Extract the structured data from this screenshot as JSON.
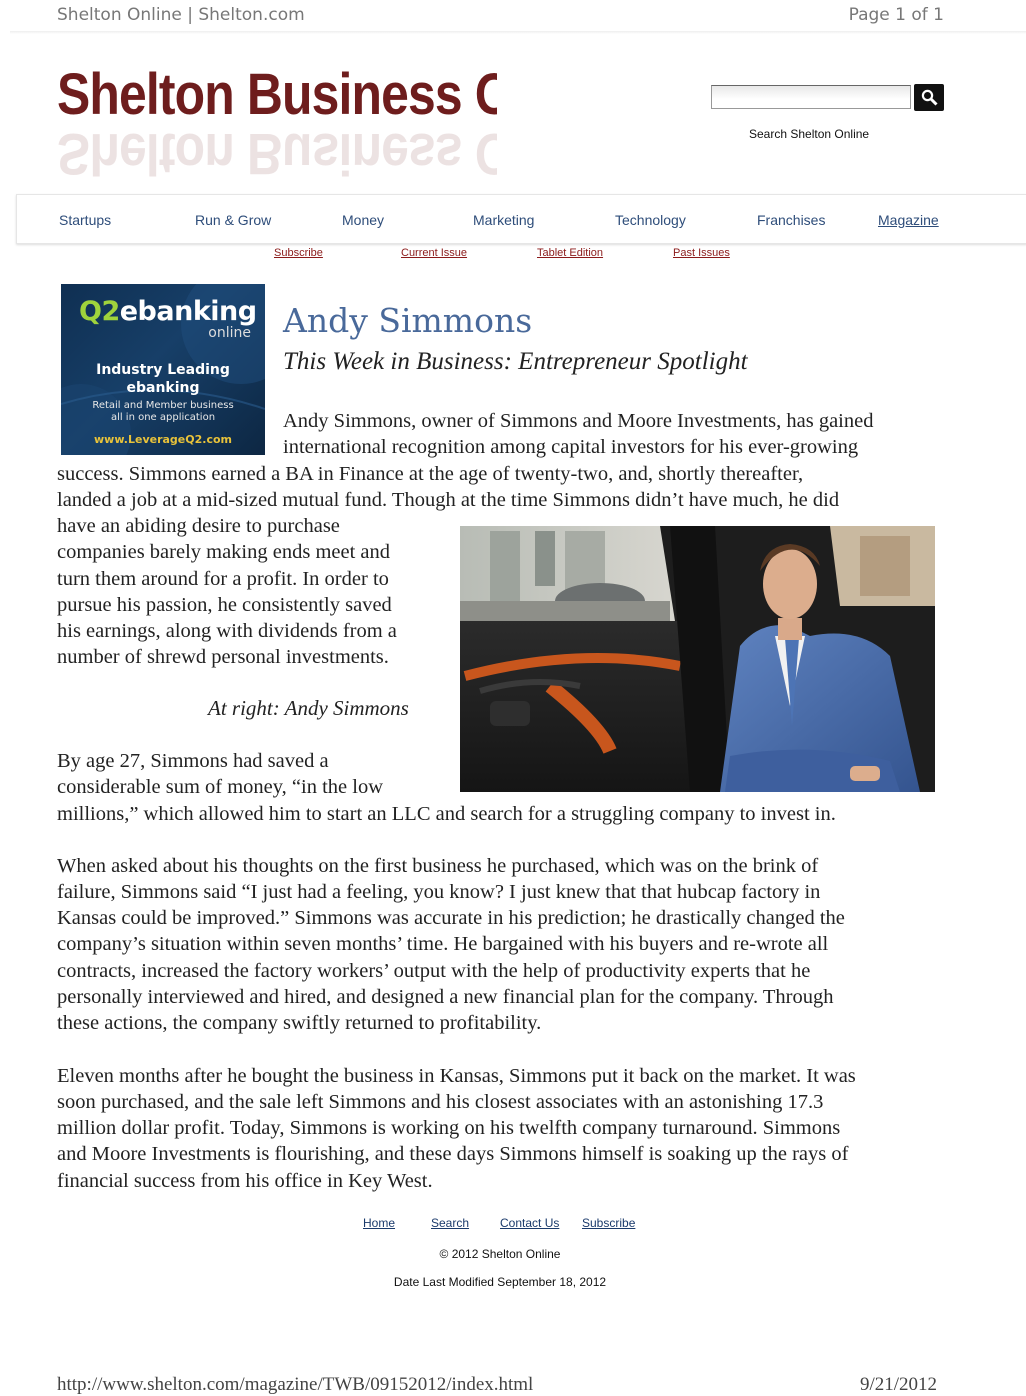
{
  "print_header": {
    "left": "Shelton Online | Shelton.com",
    "right": "Page 1 of 1"
  },
  "site": {
    "logo": "Shelton Business Online",
    "search_caption": "Search Shelton Online"
  },
  "nav": [
    "Startups",
    "Run & Grow",
    "Money",
    "Marketing",
    "Technology",
    "Franchises",
    "Magazine"
  ],
  "subnav": [
    "Subscribe",
    "Current Issue",
    "Tablet Edition",
    "Past Issues"
  ],
  "ad": {
    "logo_q2": "Q2",
    "logo_rest": "ebanking",
    "logo_sub": "online",
    "headline_1": "Industry Leading",
    "headline_2": "ebanking",
    "tagline_1": "Retail and Member business",
    "tagline_2": "all in one application",
    "url": "www.LeverageQ2.com"
  },
  "article": {
    "name": "Andy Simmons",
    "subtitle": "This Week in Business: Entrepreneur Spotlight",
    "lines_intro": [
      "Andy Simmons, owner of Simmons and Moore Investments, has gained",
      "international recognition among capital investors for his ever-growing"
    ],
    "lines_full1": [
      "success. Simmons earned a BA in Finance at the age of twenty-two, and, shortly thereafter,",
      "landed a job at a mid-sized mutual fund. Though at the time Simmons didn’t have much, he did"
    ],
    "lines_left": [
      "have an abiding desire to purchase",
      "companies barely making ends meet and",
      "turn them around for a profit. In order to",
      "pursue his passion, he consistently saved",
      "his earnings, along with dividends from a",
      "number of shrewd personal investments."
    ],
    "caption": "At right: Andy Simmons",
    "lines_left2": [
      "By age 27, Simmons had saved a",
      "considerable sum of money, “in the low"
    ],
    "line_full2": "millions,” which allowed him to start an LLC and search for a struggling company to invest in.",
    "para2": [
      "When asked about his thoughts on the first business he purchased, which was on the brink of",
      "failure, Simmons said “I just had a feeling, you know? I just knew that that hubcap factory in",
      "Kansas could be improved.” Simmons was accurate in his prediction; he drastically changed the",
      "company’s situation within seven months’ time. He bargained with his buyers and re-wrote all",
      "contracts, increased the factory workers’ output with the help of productivity experts that he",
      "personally interviewed and hired, and designed a new financial plan for the company. Through",
      "these actions, the company swiftly returned to profitability."
    ],
    "para3": [
      "Eleven months after he bought the business in Kansas, Simmons put it back on the market. It was",
      "soon purchased, and the sale left Simmons and his closest associates with an astonishing 17.3",
      "million dollar profit. Today, Simmons is working on his twelfth company turnaround. Simmons",
      "and Moore Investments is flourishing, and these days Simmons himself is soaking up the rays of",
      "financial success from his office in Key West."
    ]
  },
  "footer": {
    "links": [
      "Home",
      "Search",
      "Contact Us",
      "Subscribe"
    ],
    "copyright": "© 2012 Shelton Online",
    "modified": "Date Last Modified September 18, 2012"
  },
  "print_footer": {
    "url": "http://www.shelton.com/magazine/TWB/09152012/index.html",
    "date": "9/21/2012"
  }
}
